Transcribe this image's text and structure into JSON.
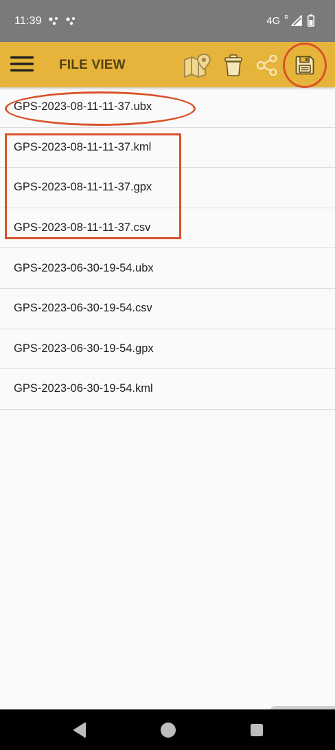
{
  "status": {
    "time": "11:39",
    "network": "4G",
    "roaming": "R"
  },
  "app_bar": {
    "title": "FILE VIEW",
    "icons": [
      "menu-icon",
      "map-pin-icon",
      "trash-icon",
      "share-icon",
      "save-icon"
    ]
  },
  "files": [
    "GPS-2023-08-11-11-37.ubx",
    "GPS-2023-08-11-11-37.kml",
    "GPS-2023-08-11-11-37.gpx",
    "GPS-2023-08-11-11-37.csv",
    "GPS-2023-06-30-19-54.ubx",
    "GPS-2023-06-30-19-54.csv",
    "GPS-2023-06-30-19-54.gpx",
    "GPS-2023-06-30-19-54.kml"
  ],
  "colors": {
    "app_bar": "#e6b43b",
    "annotation": "#d9522a",
    "status_bar": "#7a7a7a"
  }
}
